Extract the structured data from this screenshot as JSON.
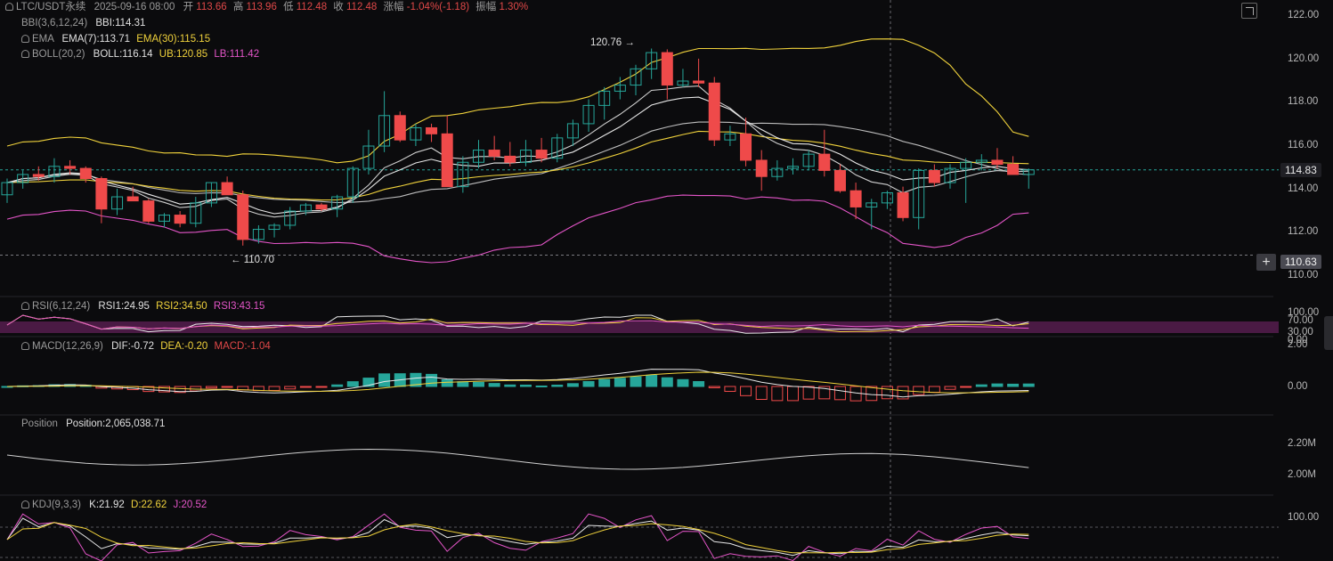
{
  "header": {
    "symbol": "LTC/USDT永续",
    "datetime": "2025-09-16 08:00",
    "open_label": "开",
    "open": "113.66",
    "high_label": "高",
    "high": "113.96",
    "low_label": "低",
    "low": "112.48",
    "close_label": "收",
    "close": "112.48",
    "change_label": "涨幅",
    "change": "-1.04%(-1.18)",
    "amp_label": "振幅",
    "amp": "1.30%"
  },
  "indicators": {
    "bbi": {
      "name": "BBI(3,6,12,24)",
      "value": "BBI:114.31"
    },
    "ema": {
      "name": "EMA",
      "v1": "EMA(7):113.71",
      "v2": "EMA(30):115.15"
    },
    "boll": {
      "name": "BOLL(20,2)",
      "v1": "BOLL:116.14",
      "v2": "UB:120.85",
      "v3": "LB:111.42"
    },
    "rsi": {
      "name": "RSI(6,12,24)",
      "v1": "RSI1:24.95",
      "v2": "RSI2:34.50",
      "v3": "RSI3:43.15"
    },
    "macd": {
      "name": "MACD(12,26,9)",
      "v1": "DIF:-0.72",
      "v2": "DEA:-0.20",
      "v3": "MACD:-1.04"
    },
    "position": {
      "name": "Position",
      "v1": "Position:2,065,038.71"
    },
    "kdj": {
      "name": "KDJ(9,3,3)",
      "v1": "K:21.92",
      "v2": "D:22.62",
      "v3": "J:20.52"
    }
  },
  "markers": {
    "high": "120.76",
    "low": "110.70",
    "high_arrow": "→",
    "low_arrow": "←"
  },
  "price_axis": [
    "122.00",
    "120.00",
    "118.00",
    "116.00",
    "114.00",
    "112.00",
    "110.00"
  ],
  "current_price": "114.83",
  "crosshair_price": "110.63",
  "rsi_axis": [
    "100.00",
    "70.00",
    "30.00",
    "0.00"
  ],
  "macd_axis": [
    "2.00",
    "0.00"
  ],
  "position_axis": [
    "2.20M",
    "2.00M"
  ],
  "kdj_axis": [
    "100.00"
  ],
  "colors": {
    "up": "#26a69a",
    "down": "#ef4a4a",
    "bbi": "#e8e8e8",
    "ema7": "#cfcfcf",
    "ema30": "#f0d23c",
    "boll_mid": "#bdbdbd",
    "boll_ub": "#f0d23c",
    "boll_lb": "#e455c8",
    "background": "#0b0b0d"
  },
  "icons": [
    "bell-icon",
    "expand-icon",
    "plus-icon"
  ],
  "chart_data": {
    "type": "candlestick",
    "ylim": [
      109.6,
      122.4
    ],
    "candles": [
      [
        113.6,
        114.4,
        113.2,
        114.2
      ],
      [
        114.2,
        114.8,
        113.9,
        114.6
      ],
      [
        114.6,
        115.0,
        114.3,
        114.5
      ],
      [
        114.5,
        115.4,
        114.2,
        115.0
      ],
      [
        115.0,
        115.3,
        114.6,
        114.9
      ],
      [
        114.9,
        115.0,
        114.2,
        114.4
      ],
      [
        114.4,
        114.5,
        112.2,
        112.9
      ],
      [
        112.9,
        113.9,
        112.6,
        113.5
      ],
      [
        113.5,
        114.0,
        113.3,
        113.3
      ],
      [
        113.3,
        113.4,
        112.2,
        112.3
      ],
      [
        112.3,
        112.7,
        112.0,
        112.6
      ],
      [
        112.6,
        112.8,
        112.0,
        112.2
      ],
      [
        112.2,
        113.5,
        112.0,
        113.2
      ],
      [
        113.2,
        114.2,
        113.0,
        114.2
      ],
      [
        114.2,
        114.5,
        113.6,
        113.6
      ],
      [
        113.6,
        113.8,
        111.1,
        111.4
      ],
      [
        111.4,
        112.1,
        111.2,
        111.9
      ],
      [
        111.9,
        112.2,
        111.5,
        112.1
      ],
      [
        112.1,
        113.0,
        111.9,
        112.8
      ],
      [
        112.8,
        113.2,
        112.6,
        113.1
      ],
      [
        113.1,
        113.2,
        112.8,
        112.9
      ],
      [
        112.9,
        113.6,
        112.5,
        113.5
      ],
      [
        113.5,
        115.0,
        113.2,
        114.9
      ],
      [
        114.9,
        116.8,
        114.6,
        116.0
      ],
      [
        116.0,
        118.7,
        115.7,
        117.5
      ],
      [
        117.5,
        117.7,
        116.2,
        116.3
      ],
      [
        116.3,
        117.1,
        116.0,
        116.9
      ],
      [
        116.9,
        117.1,
        116.2,
        116.6
      ],
      [
        116.6,
        117.5,
        114.2,
        114.0
      ],
      [
        114.0,
        115.5,
        113.7,
        115.2
      ],
      [
        115.2,
        116.3,
        114.9,
        115.8
      ],
      [
        115.8,
        116.5,
        115.3,
        115.5
      ],
      [
        115.5,
        116.2,
        115.0,
        115.2
      ],
      [
        115.2,
        116.3,
        115.0,
        115.8
      ],
      [
        115.8,
        116.4,
        115.2,
        115.4
      ],
      [
        115.4,
        116.6,
        115.2,
        116.4
      ],
      [
        116.4,
        117.3,
        116.0,
        117.1
      ],
      [
        117.1,
        118.3,
        116.7,
        118.0
      ],
      [
        118.0,
        118.9,
        117.3,
        118.7
      ],
      [
        118.7,
        119.4,
        118.3,
        119.0
      ],
      [
        119.0,
        120.0,
        118.5,
        119.8
      ],
      [
        119.8,
        120.8,
        119.3,
        120.6
      ],
      [
        120.6,
        120.76,
        118.3,
        119.0
      ],
      [
        119.0,
        119.8,
        118.9,
        119.2
      ],
      [
        119.2,
        120.3,
        118.9,
        119.1
      ],
      [
        119.1,
        119.4,
        116.0,
        116.3
      ],
      [
        116.3,
        117.0,
        116.0,
        116.6
      ],
      [
        116.6,
        117.4,
        115.0,
        115.3
      ],
      [
        115.3,
        115.8,
        113.8,
        114.5
      ],
      [
        114.5,
        115.3,
        114.3,
        114.9
      ],
      [
        114.9,
        115.4,
        114.6,
        115.0
      ],
      [
        115.0,
        115.8,
        114.8,
        115.6
      ],
      [
        115.6,
        116.8,
        114.5,
        114.8
      ],
      [
        114.8,
        115.1,
        113.7,
        113.8
      ],
      [
        113.8,
        114.2,
        112.4,
        113.0
      ],
      [
        113.0,
        113.4,
        111.9,
        113.2
      ],
      [
        113.2,
        113.8,
        112.9,
        113.7
      ],
      [
        113.7,
        114.0,
        112.3,
        112.48
      ],
      [
        112.48,
        114.9,
        111.9,
        114.8
      ],
      [
        114.8,
        115.1,
        114.0,
        114.2
      ],
      [
        114.2,
        115.1,
        113.9,
        114.9
      ],
      [
        114.9,
        115.4,
        113.2,
        115.2
      ],
      [
        115.2,
        115.6,
        114.8,
        115.3
      ],
      [
        115.3,
        115.9,
        114.9,
        115.1
      ],
      [
        115.1,
        115.5,
        114.6,
        114.6
      ],
      [
        114.6,
        114.9,
        113.9,
        114.83
      ]
    ]
  }
}
